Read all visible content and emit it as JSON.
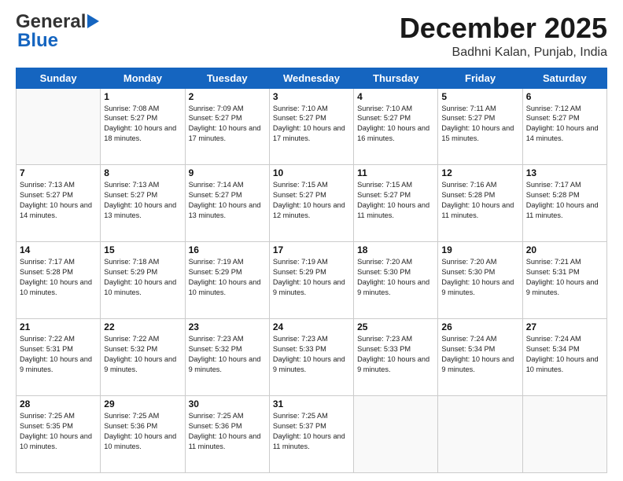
{
  "header": {
    "logo_general": "General",
    "logo_blue": "Blue",
    "month_title": "December 2025",
    "location": "Badhni Kalan, Punjab, India"
  },
  "days_of_week": [
    "Sunday",
    "Monday",
    "Tuesday",
    "Wednesday",
    "Thursday",
    "Friday",
    "Saturday"
  ],
  "weeks": [
    [
      {
        "day": "",
        "sunrise": "",
        "sunset": "",
        "daylight": ""
      },
      {
        "day": "1",
        "sunrise": "7:08 AM",
        "sunset": "5:27 PM",
        "daylight": "10 hours and 18 minutes."
      },
      {
        "day": "2",
        "sunrise": "7:09 AM",
        "sunset": "5:27 PM",
        "daylight": "10 hours and 17 minutes."
      },
      {
        "day": "3",
        "sunrise": "7:10 AM",
        "sunset": "5:27 PM",
        "daylight": "10 hours and 17 minutes."
      },
      {
        "day": "4",
        "sunrise": "7:10 AM",
        "sunset": "5:27 PM",
        "daylight": "10 hours and 16 minutes."
      },
      {
        "day": "5",
        "sunrise": "7:11 AM",
        "sunset": "5:27 PM",
        "daylight": "10 hours and 15 minutes."
      },
      {
        "day": "6",
        "sunrise": "7:12 AM",
        "sunset": "5:27 PM",
        "daylight": "10 hours and 14 minutes."
      }
    ],
    [
      {
        "day": "7",
        "sunrise": "7:13 AM",
        "sunset": "5:27 PM",
        "daylight": "10 hours and 14 minutes."
      },
      {
        "day": "8",
        "sunrise": "7:13 AM",
        "sunset": "5:27 PM",
        "daylight": "10 hours and 13 minutes."
      },
      {
        "day": "9",
        "sunrise": "7:14 AM",
        "sunset": "5:27 PM",
        "daylight": "10 hours and 13 minutes."
      },
      {
        "day": "10",
        "sunrise": "7:15 AM",
        "sunset": "5:27 PM",
        "daylight": "10 hours and 12 minutes."
      },
      {
        "day": "11",
        "sunrise": "7:15 AM",
        "sunset": "5:27 PM",
        "daylight": "10 hours and 11 minutes."
      },
      {
        "day": "12",
        "sunrise": "7:16 AM",
        "sunset": "5:28 PM",
        "daylight": "10 hours and 11 minutes."
      },
      {
        "day": "13",
        "sunrise": "7:17 AM",
        "sunset": "5:28 PM",
        "daylight": "10 hours and 11 minutes."
      }
    ],
    [
      {
        "day": "14",
        "sunrise": "7:17 AM",
        "sunset": "5:28 PM",
        "daylight": "10 hours and 10 minutes."
      },
      {
        "day": "15",
        "sunrise": "7:18 AM",
        "sunset": "5:29 PM",
        "daylight": "10 hours and 10 minutes."
      },
      {
        "day": "16",
        "sunrise": "7:19 AM",
        "sunset": "5:29 PM",
        "daylight": "10 hours and 10 minutes."
      },
      {
        "day": "17",
        "sunrise": "7:19 AM",
        "sunset": "5:29 PM",
        "daylight": "10 hours and 9 minutes."
      },
      {
        "day": "18",
        "sunrise": "7:20 AM",
        "sunset": "5:30 PM",
        "daylight": "10 hours and 9 minutes."
      },
      {
        "day": "19",
        "sunrise": "7:20 AM",
        "sunset": "5:30 PM",
        "daylight": "10 hours and 9 minutes."
      },
      {
        "day": "20",
        "sunrise": "7:21 AM",
        "sunset": "5:31 PM",
        "daylight": "10 hours and 9 minutes."
      }
    ],
    [
      {
        "day": "21",
        "sunrise": "7:22 AM",
        "sunset": "5:31 PM",
        "daylight": "10 hours and 9 minutes."
      },
      {
        "day": "22",
        "sunrise": "7:22 AM",
        "sunset": "5:32 PM",
        "daylight": "10 hours and 9 minutes."
      },
      {
        "day": "23",
        "sunrise": "7:23 AM",
        "sunset": "5:32 PM",
        "daylight": "10 hours and 9 minutes."
      },
      {
        "day": "24",
        "sunrise": "7:23 AM",
        "sunset": "5:33 PM",
        "daylight": "10 hours and 9 minutes."
      },
      {
        "day": "25",
        "sunrise": "7:23 AM",
        "sunset": "5:33 PM",
        "daylight": "10 hours and 9 minutes."
      },
      {
        "day": "26",
        "sunrise": "7:24 AM",
        "sunset": "5:34 PM",
        "daylight": "10 hours and 9 minutes."
      },
      {
        "day": "27",
        "sunrise": "7:24 AM",
        "sunset": "5:34 PM",
        "daylight": "10 hours and 10 minutes."
      }
    ],
    [
      {
        "day": "28",
        "sunrise": "7:25 AM",
        "sunset": "5:35 PM",
        "daylight": "10 hours and 10 minutes."
      },
      {
        "day": "29",
        "sunrise": "7:25 AM",
        "sunset": "5:36 PM",
        "daylight": "10 hours and 10 minutes."
      },
      {
        "day": "30",
        "sunrise": "7:25 AM",
        "sunset": "5:36 PM",
        "daylight": "10 hours and 11 minutes."
      },
      {
        "day": "31",
        "sunrise": "7:25 AM",
        "sunset": "5:37 PM",
        "daylight": "10 hours and 11 minutes."
      },
      {
        "day": "",
        "sunrise": "",
        "sunset": "",
        "daylight": ""
      },
      {
        "day": "",
        "sunrise": "",
        "sunset": "",
        "daylight": ""
      },
      {
        "day": "",
        "sunrise": "",
        "sunset": "",
        "daylight": ""
      }
    ]
  ],
  "labels": {
    "sunrise": "Sunrise:",
    "sunset": "Sunset:",
    "daylight": "Daylight:"
  }
}
